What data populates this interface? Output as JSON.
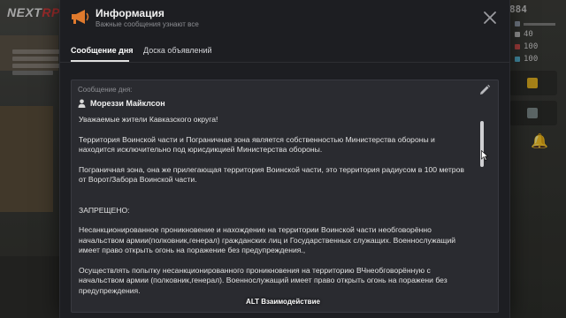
{
  "game": {
    "logo_main": "NEXT",
    "logo_accent": "RP",
    "hud": {
      "money": "884",
      "stat_1": "40",
      "stat_2": "100",
      "stat_3": "100"
    }
  },
  "colors": {
    "modal_bg": "#1d1e22",
    "panel_bg": "#2a2b30",
    "accent_icon": "#e07a2d",
    "text_primary": "#e2e2e2",
    "text_muted": "#8c8d92"
  },
  "modal": {
    "icon": "megaphone-icon",
    "title": "Информация",
    "subtitle": "Важные сообщения узнают все",
    "close_icon": "close-icon",
    "tabs": [
      {
        "label": "Сообщение дня",
        "active": true
      },
      {
        "label": "Доска объявлений",
        "active": false
      }
    ],
    "message": {
      "label": "Сообщение дня:",
      "edit_icon": "pencil-icon",
      "author_icon": "user-icon",
      "author": "Мореззи Майклсон",
      "paragraphs": [
        "Уважаемые жители Кавказского округа!",
        "Территория Воинской части и Пограничная зона является собственностью Министерства обороны  и находится исключительно под юрисдикцией Министерства обороны.",
        "Пограничная зона, она же прилегающая территория Воинской части, это территория радиусом в 100 метров от Ворот/Забора Воинской части.",
        "ЗАПРЕЩЕНО:",
        "Несанкционированное проникновение и нахождение на территории Воинской части необговорённо начальством армии(полковник,генерал) гражданских лиц и Государственных служащих. Военнослужащий имеет право открыть огонь на поражение без предупреждения.,",
        "Осуществлять попытку несанкционированного проникновения на территорию ВЧнеобговорённую с начальством армии (полковник,генерал). Военнослужащий имеет право открыть огонь на поражени без предупреждения."
      ]
    }
  },
  "hint": "ALT Взаимодействие"
}
